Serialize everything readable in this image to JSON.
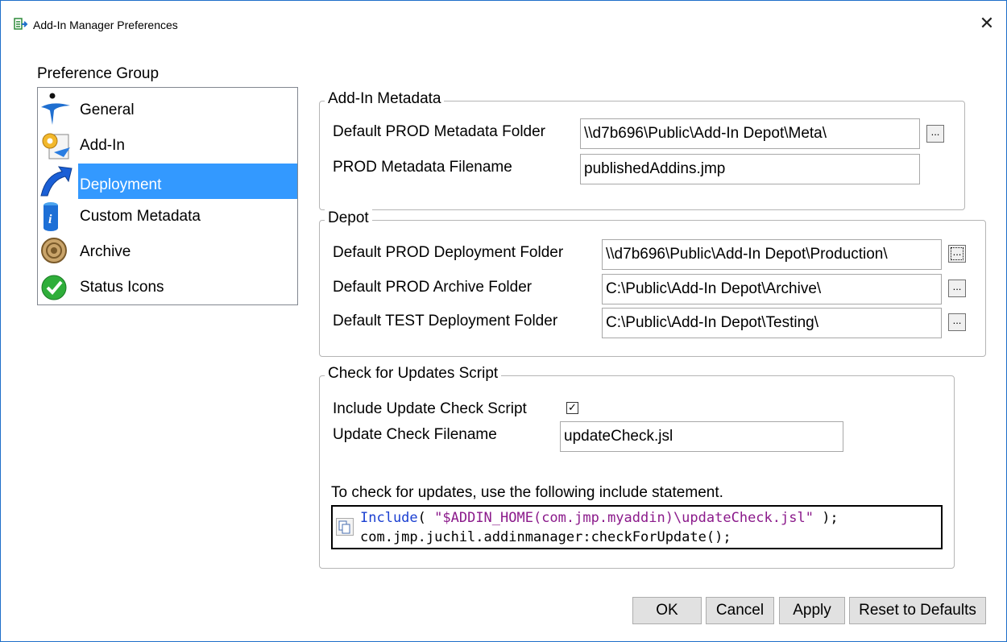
{
  "window": {
    "title": "Add-In Manager Preferences",
    "close_label": "✕"
  },
  "preference_group": {
    "label": "Preference Group",
    "items": [
      {
        "label": "General",
        "icon": "general-icon",
        "selected": false
      },
      {
        "label": "Add-In",
        "icon": "addin-icon",
        "selected": false
      },
      {
        "label": "Deployment",
        "icon": "deployment-icon",
        "selected": true
      },
      {
        "label": "Custom Metadata",
        "icon": "info-icon",
        "selected": false
      },
      {
        "label": "Archive",
        "icon": "archive-icon",
        "selected": false
      },
      {
        "label": "Status Icons",
        "icon": "check-icon",
        "selected": false
      }
    ]
  },
  "addin_metadata": {
    "title": "Add-In Metadata",
    "default_prod_folder_label": "Default PROD Metadata Folder",
    "default_prod_folder_value": "\\\\d7b696\\Public\\Add-In Depot\\Meta\\",
    "prod_filename_label": "PROD Metadata Filename",
    "prod_filename_value": "publishedAddins.jmp"
  },
  "depot": {
    "title": "Depot",
    "prod_deploy_label": "Default PROD Deployment Folder",
    "prod_deploy_value": "\\\\d7b696\\Public\\Add-In Depot\\Production\\",
    "prod_archive_label": "Default PROD Archive Folder",
    "prod_archive_value": "C:\\Public\\Add-In Depot\\Archive\\",
    "test_deploy_label": "Default TEST Deployment Folder",
    "test_deploy_value": "C:\\Public\\Add-In Depot\\Testing\\"
  },
  "browse_label": "...",
  "updates": {
    "title": "Check for Updates Script",
    "include_label": "Include Update Check Script",
    "include_checked": true,
    "include_check_mark": "✓",
    "filename_label": "Update Check Filename",
    "filename_value": "updateCheck.jsl",
    "instruction": "To check for updates, use the following include statement.",
    "code_kw": "Include",
    "code_open": "( ",
    "code_str": "\"$ADDIN_HOME(com.jmp.myaddin)\\updateCheck.jsl\"",
    "code_close": " );",
    "code_line2": "com.jmp.juchil.addinmanager:checkForUpdate();"
  },
  "buttons": {
    "ok": "OK",
    "cancel": "Cancel",
    "apply": "Apply",
    "reset": "Reset to Defaults"
  },
  "colors": {
    "selection": "#3399ff",
    "keyword": "#1a3fd1",
    "string": "#8b1a8b",
    "window_border": "#1e6fc9"
  }
}
